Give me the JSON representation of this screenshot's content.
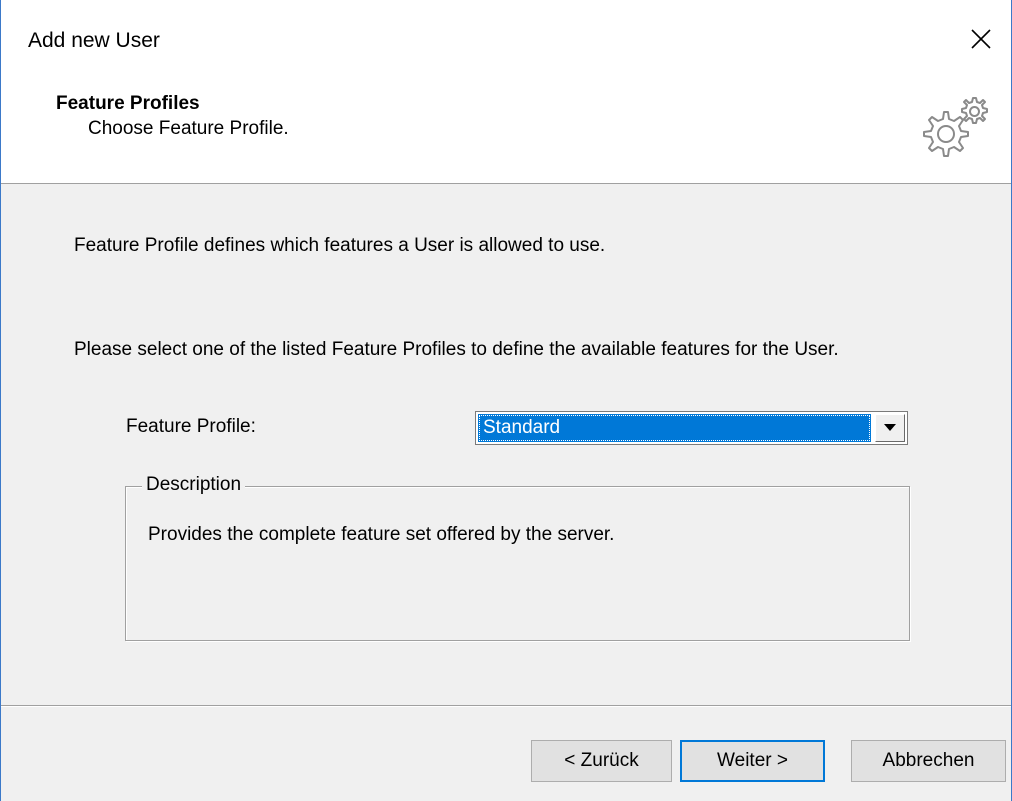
{
  "window": {
    "title": "Add new User",
    "close_icon": "close-icon"
  },
  "header": {
    "title": "Feature Profiles",
    "subtitle": "Choose Feature Profile.",
    "icon": "gears-icon"
  },
  "content": {
    "intro": "Feature Profile defines which features a User is allowed to use.",
    "instruction": "Please select one of the listed Feature Profiles to define the available features for the User.",
    "feature_profile": {
      "label": "Feature Profile:",
      "selected": "Standard",
      "arrow_icon": "dropdown-arrow-icon"
    },
    "description": {
      "legend": "Description",
      "text": "Provides the complete feature set offered by the server."
    }
  },
  "footer": {
    "back_label": "< Zurück",
    "next_label": "Weiter >",
    "cancel_label": "Abbrechen"
  },
  "colors": {
    "accent": "#0078d7",
    "window_border": "#3b79c9",
    "dialog_bg": "#f0f0f0",
    "button_bg": "#e1e1e1"
  }
}
